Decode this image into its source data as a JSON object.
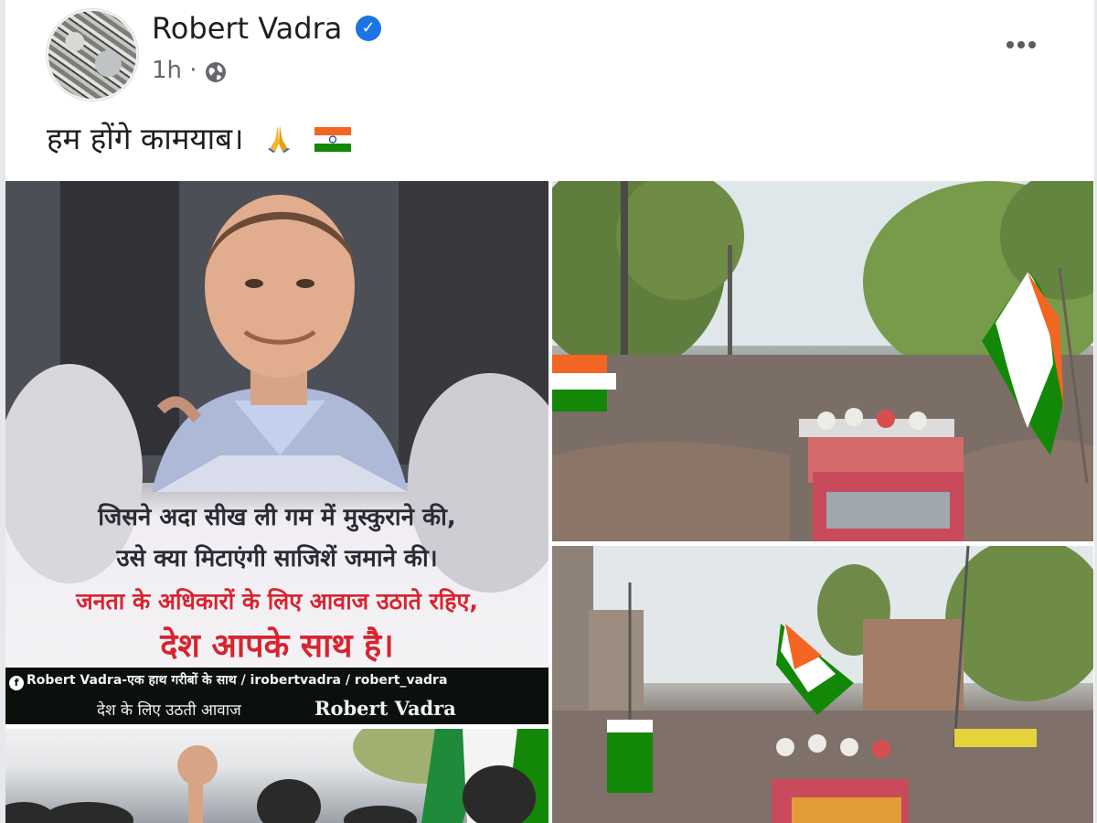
{
  "post": {
    "author": "Robert Vadra",
    "verified_icon": "verified-badge-icon",
    "time": "1h",
    "separator": "·",
    "privacy_icon": "globe-icon",
    "more_icon": "more-options-icon",
    "text": "हम होंगे कामयाब।",
    "emoji": [
      "folded-hands-icon",
      "india-flag-icon"
    ]
  },
  "poster": {
    "line1": "जिसने अदा सीख ली गम में मुस्कुराने की,",
    "line2": "उसे क्या मिटाएंगी साजिशें जमाने की।",
    "line3": "जनता के अधिकारों के लिए आवाज उठाते रहिए,",
    "line4": "देश आपके साथ है।",
    "social_line": "Robert Vadra-एक हाथ गरीबों के साथ /  irobertvadra /  robert_vadra",
    "tagline": "देश के लिए उठती आवाज",
    "signature": "Robert Vadra"
  },
  "colors": {
    "accent_blue": "#1b74e4",
    "poster_red": "#d8242f",
    "saffron": "#f26522",
    "green": "#138808"
  }
}
